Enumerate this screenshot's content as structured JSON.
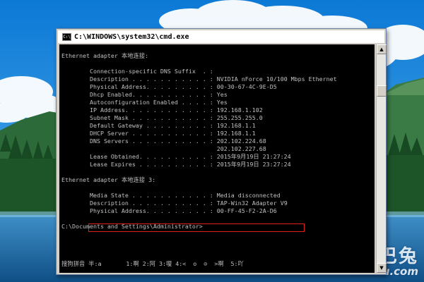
{
  "window": {
    "title": "C:\\WINDOWS\\system32\\cmd.exe",
    "icon_label": "C:\\"
  },
  "console": {
    "lines": [
      "Ethernet adapter 本地连接:",
      "",
      "        Connection-specific DNS Suffix  . :",
      "        Description . . . . . . . . . . . : NVIDIA nForce 10/100 Mbps Ethernet",
      "        Physical Address. . . . . . . . . : 00-30-67-4C-9E-D5",
      "        Dhcp Enabled. . . . . . . . . . . : Yes",
      "        Autoconfiguration Enabled . . . . : Yes",
      "        IP Address. . . . . . . . . . . . : 192.168.1.102",
      "        Subnet Mask . . . . . . . . . . . : 255.255.255.0",
      "        Default Gateway . . . . . . . . . : 192.168.1.1",
      "        DHCP Server . . . . . . . . . . . : 192.168.1.1",
      "        DNS Servers . . . . . . . . . . . : 202.102.224.68",
      "                                            202.102.227.68",
      "        Lease Obtained. . . . . . . . . . : 2015年9月19日 21:27:24",
      "        Lease Expires . . . . . . . . . . : 2015年9月19日 23:27:24",
      "",
      "Ethernet adapter 本地连接 3:",
      "",
      "        Media State . . . . . . . . . . . : Media disconnected",
      "        Description . . . . . . . . . . . : TAP-Win32 Adapter V9",
      "        Physical Address. . . . . . . . . : 00-FF-45-F2-2A-D6",
      "",
      "C:\\Documents and Settings\\Administrator>"
    ],
    "highlighted_line_index": 20,
    "ime_status": "搜狗拼音 半:a       1:啊 2:阿 3:嗄 4:<  o  ⊙  >啊  5:吖"
  },
  "watermark": {
    "main": "土巴兔",
    "sub": "tubatu.com"
  },
  "colors": {
    "console_bg": "#000000",
    "console_text": "#c0c0c0",
    "highlight_border": "#e02020",
    "titlebar_bg": "#ffffff",
    "sky": "#1d8fe0",
    "lake": "#1c6fa8"
  }
}
